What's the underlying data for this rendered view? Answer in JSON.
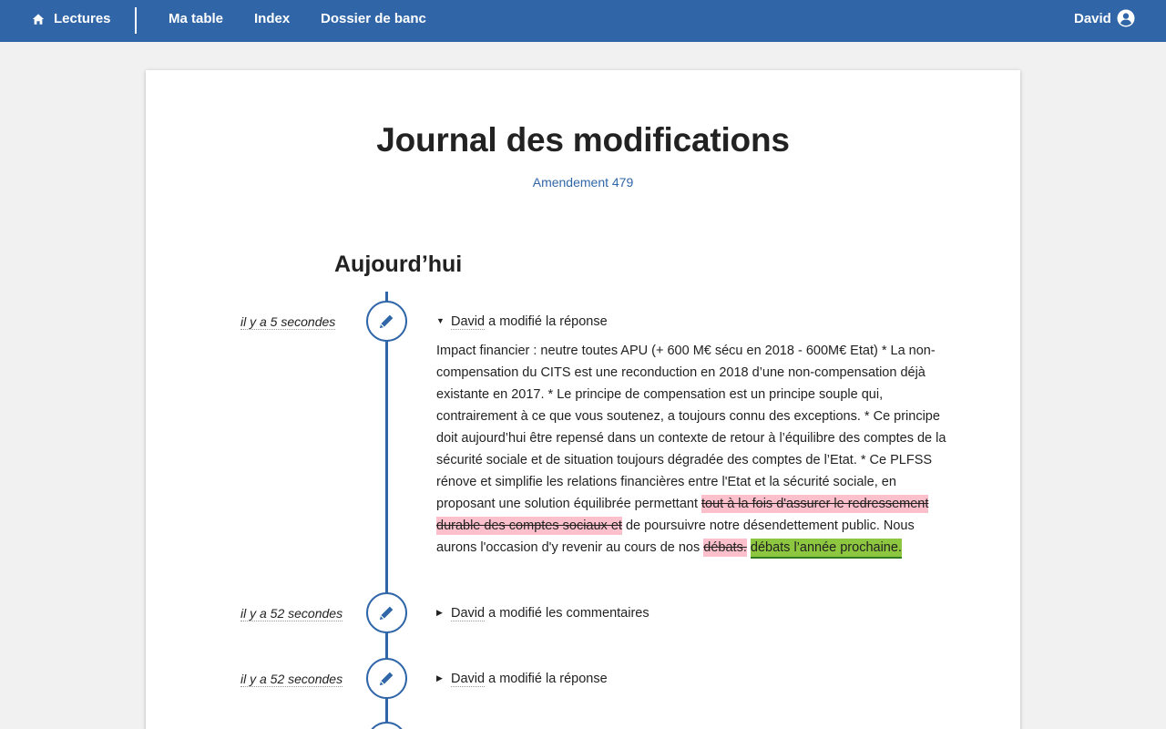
{
  "nav": {
    "lectures": "Lectures",
    "ma_table": "Ma table",
    "index": "Index",
    "dossier": "Dossier de banc",
    "user": "David"
  },
  "page": {
    "title": "Journal des modifications",
    "subtitle": "Amendement 479",
    "section": "Aujourd’hui"
  },
  "entries": [
    {
      "time": "il y a 5 secondes",
      "author": "David",
      "action": " a modifié la réponse",
      "expanded": true,
      "icon": "pencil-icon"
    },
    {
      "time": "il y a 52 secondes",
      "author": "David",
      "action": " a modifié les commentaires",
      "expanded": false,
      "icon": "pencil-icon"
    },
    {
      "time": "il y a 52 secondes",
      "author": "David",
      "action": " a modifié la réponse",
      "expanded": false,
      "icon": "pencil-icon"
    }
  ],
  "diff": {
    "text1": "Impact financier : neutre toutes APU (+ 600 M€ sécu en 2018 - 600M€ Etat) * La non-compensation du CITS est une reconduction en 2018 d’une non-compensation déjà existante en 2017. * Le principe de compensation est un principe souple qui, contrairement à ce que vous soutenez, a toujours connu des exceptions. * Ce principe doit aujourd’hui être repensé dans un contexte de retour à l’équilibre des comptes de la sécurité sociale et de situation toujours dégradée des comptes de l’Etat. * Ce PLFSS rénove et simplifie les relations financières entre l'Etat et la sécurité sociale, en proposant une solution équilibrée permettant ",
    "del1": "tout à la fois d'assurer le redressement durable des comptes sociaux et",
    "text2": " de poursuivre notre désendettement public. Nous aurons l'occasion d'y revenir au cours de nos ",
    "del2": "débats.",
    "ins1": "débats l’année prochaine."
  },
  "colors": {
    "brand": "#3066a8",
    "deletion": "#fbc0cb",
    "insertion": "#8dc63f"
  },
  "icons": [
    "home-icon",
    "user-circle-icon",
    "pencil-icon",
    "caret-down-icon",
    "caret-right-icon"
  ]
}
